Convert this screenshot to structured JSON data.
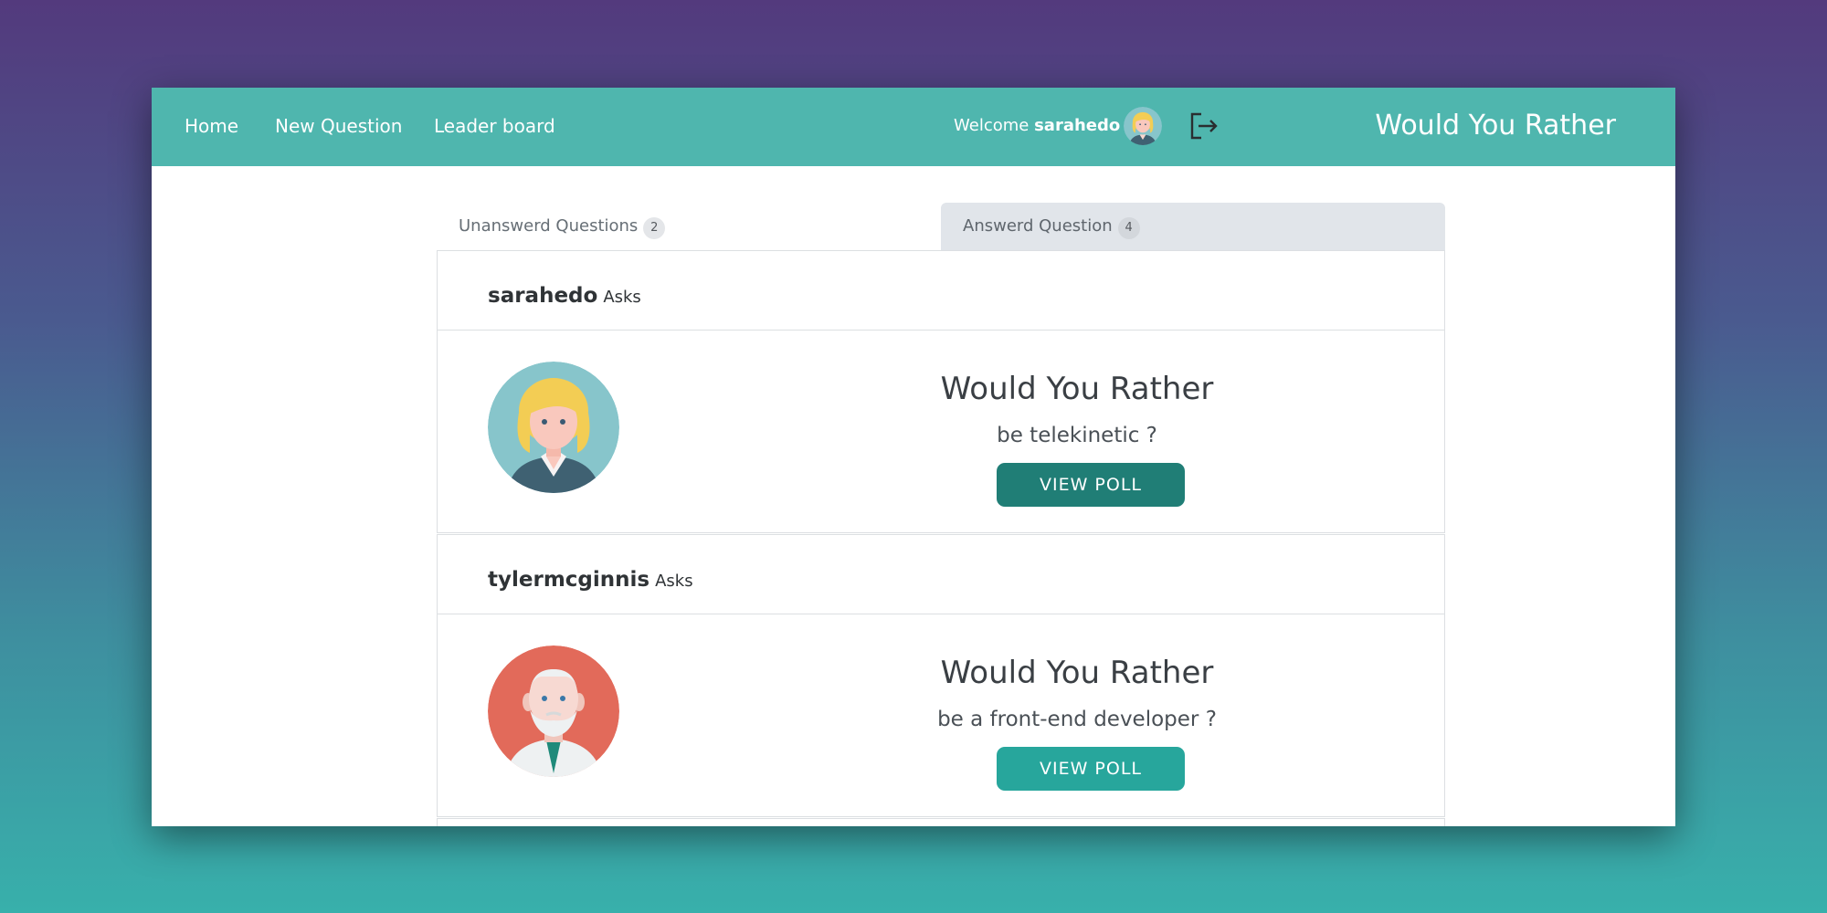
{
  "nav": {
    "links": [
      "Home",
      "New Question",
      "Leader board"
    ],
    "welcome_prefix": "Welcome",
    "username": "sarahedo",
    "brand": "Would You Rather"
  },
  "tabs": [
    {
      "label": "Unanswerd Questions",
      "count": "2",
      "active": false
    },
    {
      "label": "Answerd Question",
      "count": "4",
      "active": true
    }
  ],
  "questions": [
    {
      "author": "sarahedo",
      "asks": "Asks",
      "title": "Would You Rather",
      "option": "be telekinetic ?",
      "button": "VIEW POLL",
      "avatar": "woman-blonde-avatar"
    },
    {
      "author": "tylermcginnis",
      "asks": "Asks",
      "title": "Would You Rather",
      "option": "be a front-end developer ?",
      "button": "VIEW POLL",
      "avatar": "old-man-avatar"
    }
  ],
  "colors": {
    "navbar": "#4fb6ae",
    "button_dark": "#207e76",
    "button_light": "#27a69c",
    "tab_active_bg": "#e1e5ea"
  },
  "icons": {
    "logout": "logout-icon"
  }
}
